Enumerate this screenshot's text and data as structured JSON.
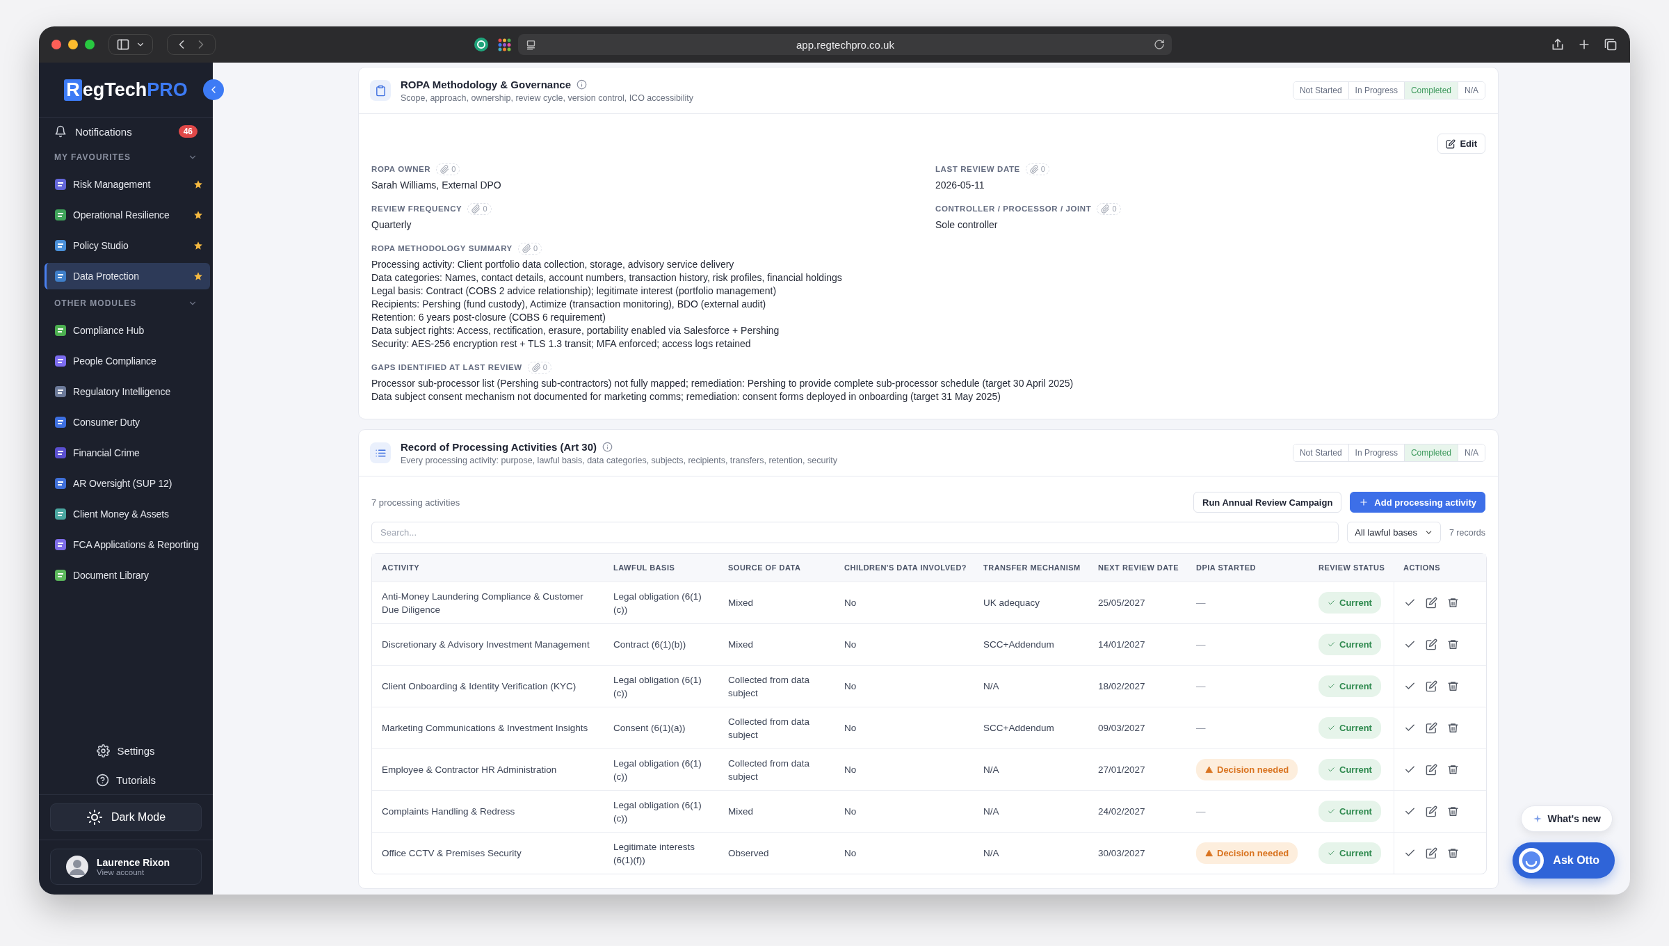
{
  "browser": {
    "url": "app.regtechpro.co.uk"
  },
  "sidebar": {
    "logo": {
      "badge": "R",
      "text": "egTech",
      "accent": "PRO"
    },
    "notifications": {
      "label": "Notifications",
      "count": "46"
    },
    "sections": [
      {
        "title": "MY FAVOURITES",
        "expanded": true,
        "items": [
          {
            "label": "Risk Management",
            "color": "#6366d9",
            "starred": true,
            "selected": false
          },
          {
            "label": "Operational Resilience",
            "color": "#3fa45a",
            "starred": true,
            "selected": false
          },
          {
            "label": "Policy Studio",
            "color": "#4a90d9",
            "starred": true,
            "selected": false
          },
          {
            "label": "Data Protection",
            "color": "#3f7fc9",
            "starred": true,
            "selected": true
          }
        ]
      },
      {
        "title": "OTHER MODULES",
        "expanded": true,
        "items": [
          {
            "label": "Compliance Hub",
            "color": "#4caf50",
            "selected": false
          },
          {
            "label": "People Compliance",
            "color": "#7c6cf0",
            "selected": false
          },
          {
            "label": "Regulatory Intelligence",
            "color": "#6c7a99",
            "selected": false
          },
          {
            "label": "Consumer Duty",
            "color": "#3d6fe0",
            "selected": false
          },
          {
            "label": "Financial Crime",
            "color": "#5a4fd0",
            "selected": false
          },
          {
            "label": "AR Oversight (SUP 12)",
            "color": "#3f6fd8",
            "selected": false
          },
          {
            "label": "Client Money & Assets",
            "color": "#4aa6a0",
            "selected": false
          },
          {
            "label": "FCA Applications & Reporting",
            "color": "#7e6ce8",
            "selected": false
          },
          {
            "label": "Document Library",
            "color": "#5cb85c",
            "selected": false
          }
        ]
      }
    ],
    "footer_links": [
      {
        "label": "Settings",
        "kind": "settings"
      },
      {
        "label": "Tutorials",
        "kind": "help"
      }
    ],
    "theme_toggle": {
      "label": "Dark Mode"
    },
    "account": {
      "name": "Laurence Rixon",
      "subtitle": "View account"
    }
  },
  "methodology": {
    "title": "ROPA Methodology & Governance",
    "subtitle": "Scope, approach, ownership, review cycle, version control, ICO accessibility",
    "status": [
      {
        "label": "Not Started",
        "selected": false
      },
      {
        "label": "In Progress",
        "selected": false
      },
      {
        "label": "Completed",
        "selected": true
      },
      {
        "label": "N/A",
        "selected": false
      }
    ],
    "edit_button": "Edit",
    "field_rows": [
      [
        {
          "label": "ROPA OWNER",
          "attachments": "0",
          "lines": [
            "Sarah Williams, External DPO"
          ]
        },
        {
          "label": "LAST REVIEW DATE",
          "attachments": "0",
          "lines": [
            "2026-05-11"
          ]
        }
      ],
      [
        {
          "label": "REVIEW FREQUENCY",
          "attachments": "0",
          "lines": [
            "Quarterly"
          ]
        },
        {
          "label": "CONTROLLER / PROCESSOR / JOINT",
          "attachments": "0",
          "lines": [
            "Sole controller"
          ]
        }
      ],
      [
        {
          "label": "ROPA METHODOLOGY SUMMARY",
          "attachments": "0",
          "lines": [
            "Processing activity: Client portfolio data collection, storage, advisory service delivery",
            "Data categories: Names, contact details, account numbers, transaction history, risk profiles, financial holdings",
            "Legal basis: Contract (COBS 2 advice relationship); legitimate interest (portfolio management)",
            "Recipients: Pershing (fund custody), Actimize (transaction monitoring), BDO (external audit)",
            "Retention: 6 years post-closure (COBS 6 requirement)",
            "Data subject rights: Access, rectification, erasure, portability enabled via Salesforce + Pershing",
            "Security: AES-256 encryption rest + TLS 1.3 transit; MFA enforced; access logs retained"
          ]
        }
      ],
      [
        {
          "label": "GAPS IDENTIFIED AT LAST REVIEW",
          "attachments": "0",
          "lines": [
            "Processor sub-processor list (Pershing sub-contractors) not fully mapped; remediation: Pershing to provide complete sub-processor schedule (target 30 April 2025)",
            "Data subject consent mechanism not documented for marketing comms; remediation: consent forms deployed in onboarding (target 31 May 2025)"
          ]
        }
      ]
    ]
  },
  "activities": {
    "title": "Record of Processing Activities (Art 30)",
    "subtitle": "Every processing activity: purpose, lawful basis, data categories, subjects, recipients, transfers, retention, security",
    "status": [
      {
        "label": "Not Started",
        "selected": false
      },
      {
        "label": "In Progress",
        "selected": false
      },
      {
        "label": "Completed",
        "selected": true
      },
      {
        "label": "N/A",
        "selected": false
      }
    ],
    "count_label": "7 processing activities",
    "buttons": [
      {
        "label": "Run Annual Review Campaign",
        "kind": "secondary"
      },
      {
        "label": "Add processing activity",
        "kind": "primary"
      }
    ],
    "search": {
      "placeholder": "Search..."
    },
    "filter": {
      "value": "All lawful bases"
    },
    "records": "7 records",
    "table": {
      "columns": [
        "ACTIVITY",
        "LAWFUL BASIS",
        "SOURCE OF DATA",
        "CHILDREN'S DATA INVOLVED?",
        "TRANSFER MECHANISM",
        "NEXT REVIEW DATE",
        "DPIA STARTED",
        "REVIEW STATUS",
        "ACTIONS"
      ],
      "rows": [
        {
          "activity": "Anti-Money Laundering Compliance & Customer Due Diligence",
          "lawful_basis": "Legal obligation (6(1)(c))",
          "source": "Mixed",
          "childrens_data": "No",
          "transfer": "UK adequacy",
          "next_review": "25/05/2027",
          "dpia": {
            "kind": "none",
            "text": "—"
          },
          "review_status": "Current"
        },
        {
          "activity": "Discretionary & Advisory Investment Management",
          "lawful_basis": "Contract (6(1)(b))",
          "source": "Mixed",
          "childrens_data": "No",
          "transfer": "SCC+Addendum",
          "next_review": "14/01/2027",
          "dpia": {
            "kind": "none",
            "text": "—"
          },
          "review_status": "Current"
        },
        {
          "activity": "Client Onboarding & Identity Verification (KYC)",
          "lawful_basis": "Legal obligation (6(1)(c))",
          "source": "Collected from data subject",
          "childrens_data": "No",
          "transfer": "N/A",
          "next_review": "18/02/2027",
          "dpia": {
            "kind": "none",
            "text": "—"
          },
          "review_status": "Current"
        },
        {
          "activity": "Marketing Communications & Investment Insights",
          "lawful_basis": "Consent (6(1)(a))",
          "source": "Collected from data subject",
          "childrens_data": "No",
          "transfer": "SCC+Addendum",
          "next_review": "09/03/2027",
          "dpia": {
            "kind": "none",
            "text": "—"
          },
          "review_status": "Current"
        },
        {
          "activity": "Employee & Contractor HR Administration",
          "lawful_basis": "Legal obligation (6(1)(c))",
          "source": "Collected from data subject",
          "childrens_data": "No",
          "transfer": "N/A",
          "next_review": "27/01/2027",
          "dpia": {
            "kind": "warning",
            "text": "Decision needed"
          },
          "review_status": "Current"
        },
        {
          "activity": "Complaints Handling & Redress",
          "lawful_basis": "Legal obligation (6(1)(c))",
          "source": "Mixed",
          "childrens_data": "No",
          "transfer": "N/A",
          "next_review": "24/02/2027",
          "dpia": {
            "kind": "none",
            "text": "—"
          },
          "review_status": "Current"
        },
        {
          "activity": "Office CCTV & Premises Security",
          "lawful_basis": "Legitimate interests (6(1)(f))",
          "source": "Observed",
          "childrens_data": "No",
          "transfer": "N/A",
          "next_review": "30/03/2027",
          "dpia": {
            "kind": "warning",
            "text": "Decision needed"
          },
          "review_status": "Current"
        }
      ]
    }
  },
  "floating": {
    "whats_new": "What's new",
    "ask": "Ask Otto"
  }
}
